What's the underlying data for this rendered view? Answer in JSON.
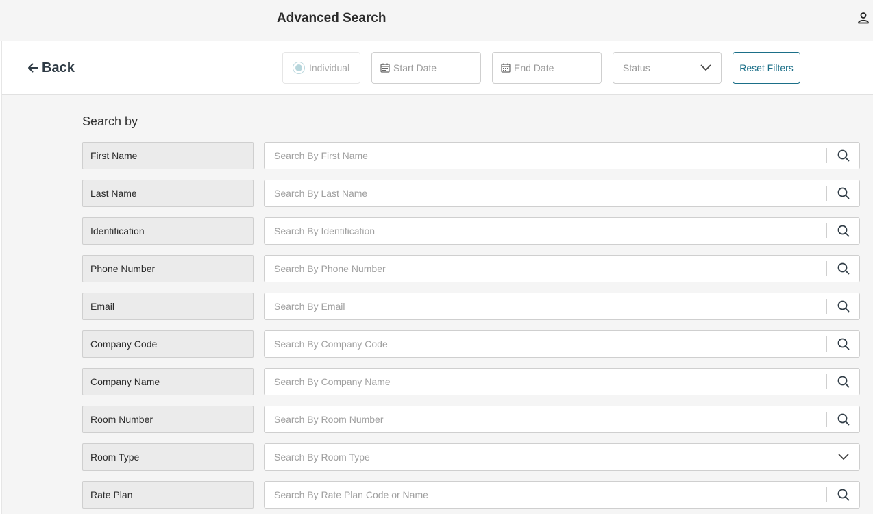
{
  "header": {
    "title": "Advanced Search",
    "user_icon": "user-icon"
  },
  "filters": {
    "back_label": "Back",
    "individual_label": "Individual",
    "start_date_placeholder": "Start Date",
    "end_date_placeholder": "End Date",
    "status_label": "Status",
    "reset_label": "Reset Filters"
  },
  "search": {
    "heading": "Search by",
    "rows": [
      {
        "label": "First Name",
        "placeholder": "Search By First Name",
        "control": "search"
      },
      {
        "label": "Last Name",
        "placeholder": "Search By Last Name",
        "control": "search"
      },
      {
        "label": "Identification",
        "placeholder": "Search By Identification",
        "control": "search"
      },
      {
        "label": "Phone Number",
        "placeholder": "Search By Phone Number",
        "control": "search"
      },
      {
        "label": "Email",
        "placeholder": "Search By Email",
        "control": "search"
      },
      {
        "label": "Company Code",
        "placeholder": "Search By Company Code",
        "control": "search"
      },
      {
        "label": "Company Name",
        "placeholder": "Search By Company Name",
        "control": "search"
      },
      {
        "label": "Room Number",
        "placeholder": "Search By Room Number",
        "control": "search"
      },
      {
        "label": "Room Type",
        "placeholder": "Search By Room Type",
        "control": "dropdown"
      },
      {
        "label": "Rate Plan",
        "placeholder": "Search By Rate Plan Code or Name",
        "control": "search"
      }
    ]
  },
  "colors": {
    "accent": "#1b6f88",
    "label_bg": "#ebebeb",
    "page_bg": "#f5f5f5"
  }
}
